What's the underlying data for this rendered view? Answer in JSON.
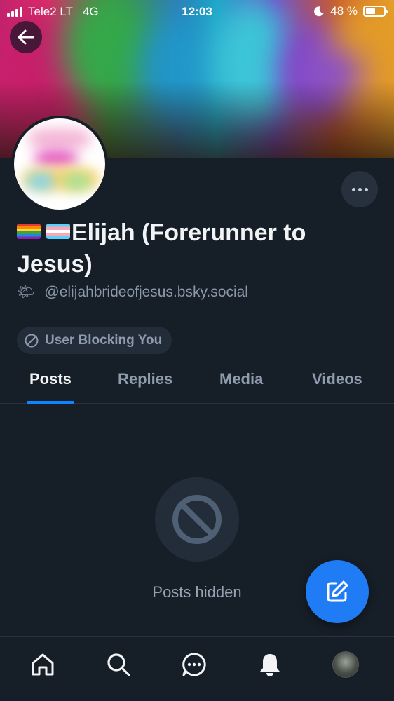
{
  "status_bar": {
    "carrier": "Tele2 LT",
    "network": "4G",
    "time": "12:03",
    "battery": "48 %",
    "battery_level": 0.48
  },
  "profile": {
    "display_name": "Elijah (Forerunner to Jesus)",
    "handle_emoji": "🌤",
    "handle": "@elijahbrideofjesus.bsky.social",
    "blocked_label": "User Blocking You"
  },
  "tabs": [
    {
      "label": "Posts",
      "active": true
    },
    {
      "label": "Replies",
      "active": false
    },
    {
      "label": "Media",
      "active": false
    },
    {
      "label": "Videos",
      "active": false
    }
  ],
  "empty_state": {
    "label": "Posts hidden"
  },
  "icons": {
    "back": "arrow-left-icon",
    "more": "more-horizontal-icon",
    "blocked": "no-entry-icon",
    "compose": "compose-icon",
    "nav": [
      "home-icon",
      "search-icon",
      "chat-icon",
      "bell-icon",
      "avatar"
    ]
  },
  "colors": {
    "background": "#161e27",
    "accent": "#1083fe",
    "fab": "#1f7cf5",
    "muted_text": "#8f9cad"
  }
}
